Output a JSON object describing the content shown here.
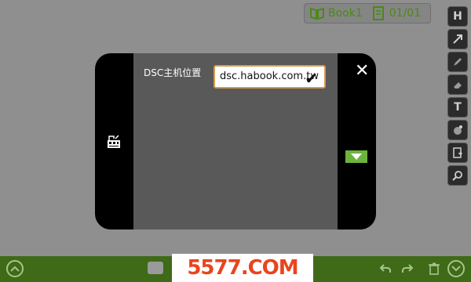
{
  "header": {
    "book_label": "Book1",
    "page_label": "01/01"
  },
  "toolbar": {
    "tools": [
      {
        "name": "highlight",
        "icon": "HL"
      },
      {
        "name": "pointer",
        "icon": "pointer-icon"
      },
      {
        "name": "pen",
        "icon": "pen-icon"
      },
      {
        "name": "eraser",
        "icon": "eraser-icon"
      },
      {
        "name": "text",
        "icon": "T"
      },
      {
        "name": "fill",
        "icon": "fill-icon"
      },
      {
        "name": "page-add",
        "icon": "page-add-icon"
      },
      {
        "name": "search",
        "icon": "search-icon"
      }
    ]
  },
  "dialog": {
    "label": "DSC主机位置",
    "input_value": "dsc.habook.com.tw",
    "close_icon": "close-icon",
    "confirm_icon": "check-icon",
    "dropdown_icon": "dropdown-icon",
    "server_icon": "server-icon"
  },
  "bottombar": {
    "up_icon": "chevron-up-icon",
    "camera_icon": "camera-icon",
    "undo_icon": "undo-icon",
    "redo_icon": "redo-icon",
    "trash_icon": "trash-icon",
    "down_icon": "chevron-down-icon"
  },
  "watermark": {
    "text": "5577.COM"
  },
  "colors": {
    "accent_green": "#6db33f",
    "bar_green": "#3f6a18",
    "input_border": "#d89a4a",
    "watermark_red": "#e8451e"
  }
}
